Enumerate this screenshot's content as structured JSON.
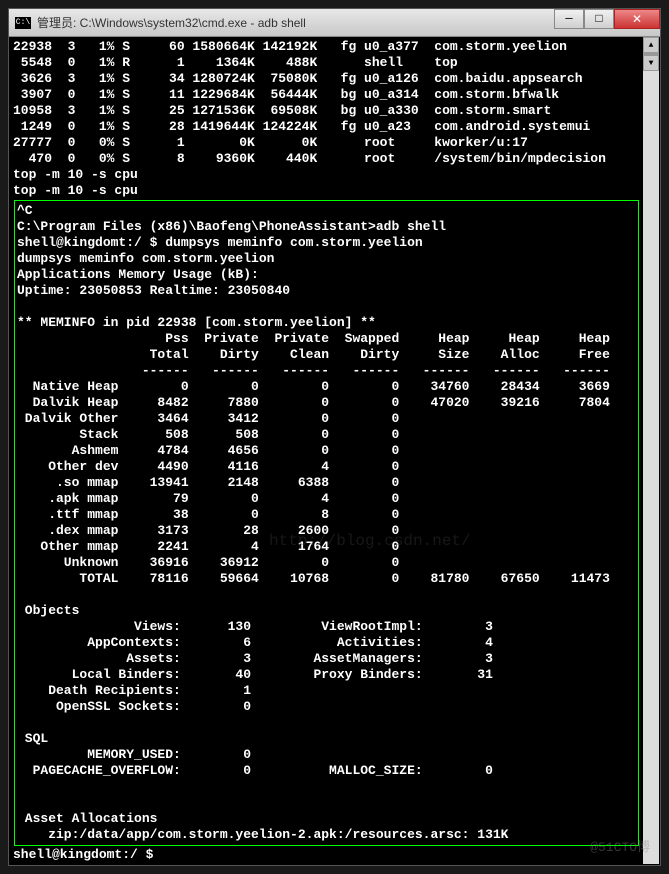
{
  "title": "管理员: C:\\Windows\\system32\\cmd.exe - adb  shell",
  "proc_rows": [
    [
      "22938",
      "3",
      "1%",
      "S",
      "60",
      "1580664K",
      "142192K",
      "fg",
      "u0_a377",
      "com.storm.yeelion"
    ],
    [
      " 5548",
      "0",
      "1%",
      "R",
      " 1",
      "   1364K",
      "   488K",
      "  ",
      "shell  ",
      "top"
    ],
    [
      " 3626",
      "3",
      "1%",
      "S",
      "34",
      "1280724K",
      " 75080K",
      "fg",
      "u0_a126",
      "com.baidu.appsearch"
    ],
    [
      " 3907",
      "0",
      "1%",
      "S",
      "11",
      "1229684K",
      " 56444K",
      "bg",
      "u0_a314",
      "com.storm.bfwalk"
    ],
    [
      "10958",
      "3",
      "1%",
      "S",
      "25",
      "1271536K",
      " 69508K",
      "bg",
      "u0_a330",
      "com.storm.smart"
    ],
    [
      " 1249",
      "0",
      "1%",
      "S",
      "28",
      "1419644K",
      "124224K",
      "fg",
      "u0_a23 ",
      "com.android.systemui"
    ],
    [
      "27777",
      "0",
      "0%",
      "S",
      " 1",
      "      0K",
      "     0K",
      "  ",
      "root   ",
      "kworker/u:17"
    ],
    [
      "  470",
      "0",
      "0%",
      "S",
      " 8",
      "   9360K",
      "   440K",
      "  ",
      "root   ",
      "/system/bin/mpdecision"
    ]
  ],
  "top_cmd1": "top -m 10 -s cpu",
  "top_cmd2": "top -m 10 -s cpu",
  "ctrl_c": "^C",
  "prompt1": "C:\\Program Files (x86)\\Baofeng\\PhoneAssistant>adb shell",
  "shell_line": "shell@kingdomt:/ $ dumpsys meminfo com.storm.yeelion",
  "echo_cmd": "dumpsys meminfo com.storm.yeelion",
  "app_mem": "Applications Memory Usage (kB):",
  "uptime": "Uptime: 23050853 Realtime: 23050840",
  "meminfo_hdr": "** MEMINFO in pid 22938 [com.storm.yeelion] **",
  "col_hdr1": "                   Pss  Private  Private  Swapped     Heap     Heap     Heap",
  "col_hdr2": "                 Total    Dirty    Clean    Dirty     Size    Alloc     Free",
  "col_sep": "                ------   ------   ------   ------   ------   ------   ------",
  "mem_rows": [
    "  Native Heap        0        0        0        0    34760    28434     3669",
    "  Dalvik Heap     8482     7880        0        0    47020    39216     7804",
    " Dalvik Other     3464     3412        0        0",
    "        Stack      508      508        0        0",
    "       Ashmem     4784     4656        0        0",
    "    Other dev     4490     4116        4        0",
    "     .so mmap    13941     2148     6388        0",
    "    .apk mmap       79        0        4        0",
    "    .ttf mmap       38        0        8        0",
    "    .dex mmap     3173       28     2600        0",
    "   Other mmap     2241        4     1764        0",
    "      Unknown    36916    36912        0        0",
    "        TOTAL    78116    59664    10768        0    81780    67650    11473"
  ],
  "objects_hdr": " Objects",
  "obj_rows": [
    "               Views:      130         ViewRootImpl:        3",
    "         AppContexts:        6           Activities:        4",
    "              Assets:        3        AssetManagers:        3",
    "       Local Binders:       40        Proxy Binders:       31",
    "    Death Recipients:        1",
    "     OpenSSL Sockets:        0"
  ],
  "sql_hdr": " SQL",
  "sql_rows": [
    "         MEMORY_USED:        0",
    "  PAGECACHE_OVERFLOW:        0          MALLOC_SIZE:        0"
  ],
  "asset_hdr": " Asset Allocations",
  "asset_row": "    zip:/data/app/com.storm.yeelion-2.apk:/resources.arsc: 131K",
  "final_prompt": "shell@kingdomt:/ $ ",
  "watermark1": "http://blog.csdn.net/",
  "watermark2": "@51CTO博"
}
